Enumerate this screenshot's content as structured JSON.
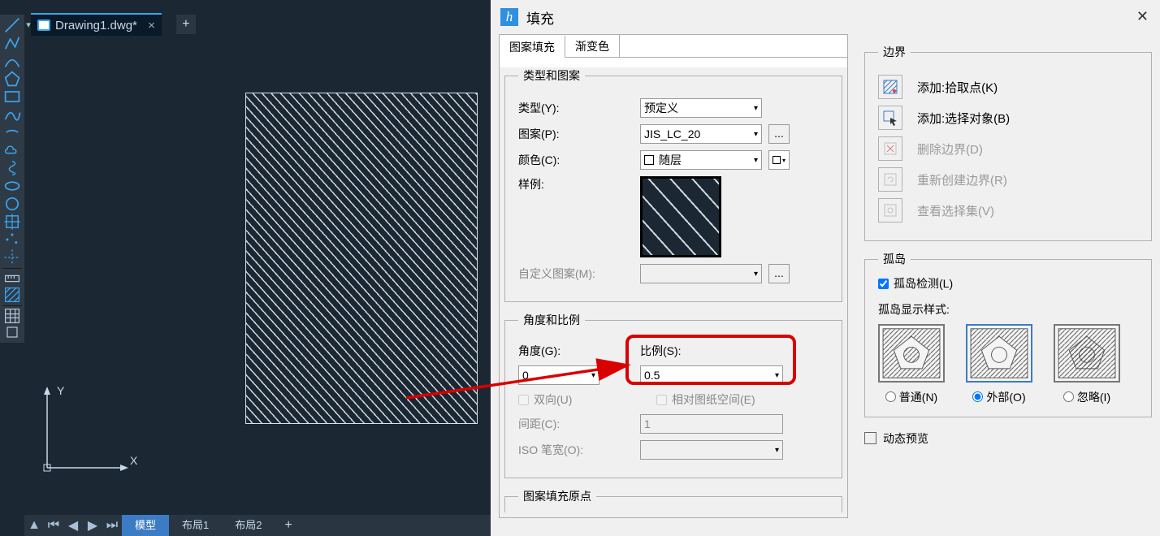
{
  "file_tab": {
    "name": "Drawing1.dwg*",
    "close": "×"
  },
  "new_tab_plus": "+",
  "ucs": {
    "x": "X",
    "y": "Y"
  },
  "status": {
    "model": "模型",
    "layout1": "布局1",
    "layout2": "布局2",
    "plus": "+"
  },
  "dialog": {
    "title": "填充",
    "tabs": {
      "hatch": "图案填充",
      "gradient": "渐变色"
    },
    "type_pattern_group": "类型和图案",
    "type_label": "类型(Y):",
    "type_value": "预定义",
    "pattern_label": "图案(P):",
    "pattern_value": "JIS_LC_20",
    "more_btn": "...",
    "color_label": "颜色(C):",
    "color_value": "随层",
    "sample_label": "样例:",
    "custom_label": "自定义图案(M):",
    "angle_scale_group": "角度和比例",
    "angle_label": "角度(G):",
    "angle_value": "0",
    "scale_label": "比例(S):",
    "scale_value": "0.5",
    "double_label": "双向(U)",
    "paper_label": "相对图纸空间(E)",
    "spacing_label": "间距(C):",
    "spacing_value": "1",
    "iso_label": "ISO 笔宽(O):",
    "origin_group": "图案填充原点",
    "boundary_group": "边界",
    "btn_pick": "添加:拾取点(K)",
    "btn_select": "添加:选择对象(B)",
    "btn_remove": "删除边界(D)",
    "btn_recreate": "重新创建边界(R)",
    "btn_view": "查看选择集(V)",
    "island_group": "孤岛",
    "island_detect": "孤岛检测(L)",
    "island_style": "孤岛显示样式:",
    "island_normal": "普通(N)",
    "island_outer": "外部(",
    "island_outer_u": "O",
    "island_outer2": ")",
    "island_ignore": "忽略(I)",
    "dynamic_preview": "动态预览"
  }
}
